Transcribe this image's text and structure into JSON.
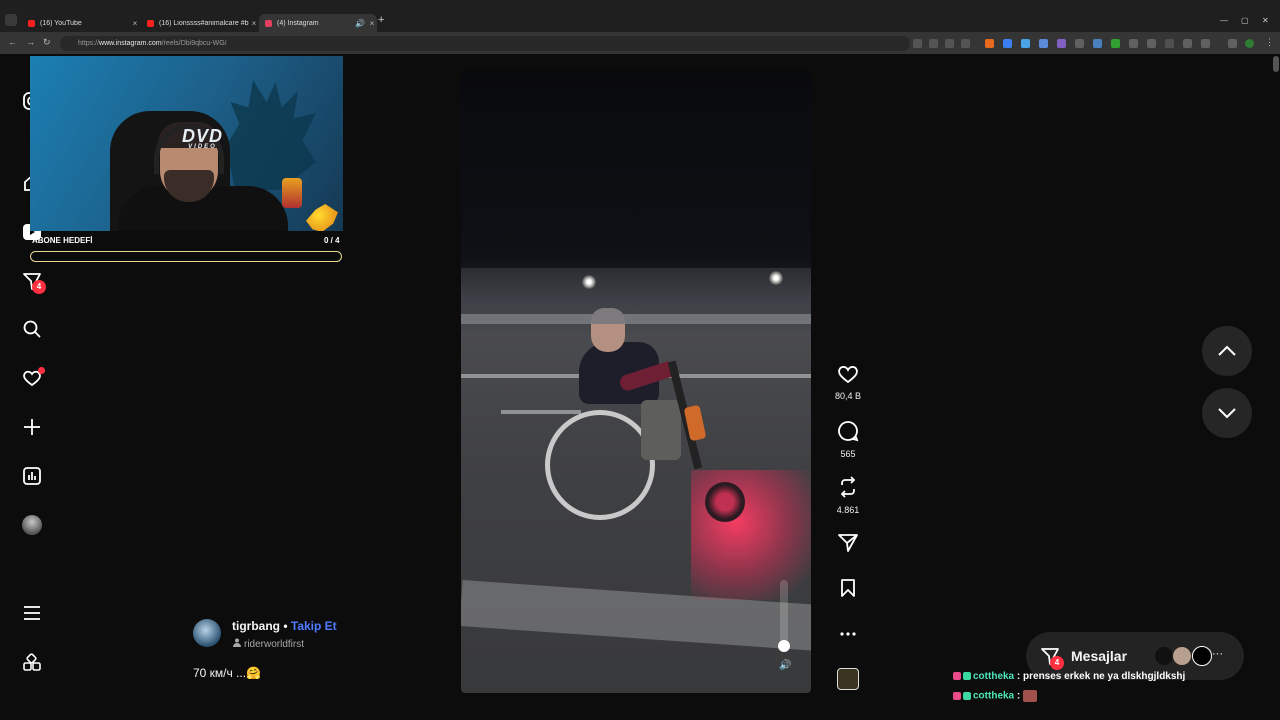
{
  "browser": {
    "tabs": [
      {
        "title": "(16) YouTube",
        "favicon_color": "#ff2020",
        "active": false
      },
      {
        "title": "(16) Lionssss#animalcare #big",
        "favicon_color": "#ff2020",
        "active": false
      },
      {
        "title": "(4) Instagram",
        "favicon_color": "#e4405f",
        "active": true
      }
    ],
    "close_glyph": "×",
    "new_tab_glyph": "+",
    "url_prefix": "https://",
    "url_host": "www.instagram.com",
    "url_path": "/reels/Dbi9qbcu-WG/",
    "window_controls": [
      "—",
      "▢",
      "✕"
    ]
  },
  "overlay": {
    "goal_label": "ABONE HEDEFİ",
    "goal_count": "0 / 4",
    "dvd_text": "DVD",
    "dvd_sub": "VIDEO"
  },
  "sidebar": {
    "icons": [
      "instagram-icon",
      "home-icon",
      "reels-icon",
      "direct-icon",
      "search-icon",
      "notifications-icon",
      "create-icon",
      "dashboard-icon",
      "profile-avatar",
      "menu-icon",
      "apps-icon"
    ],
    "direct_badge": "4"
  },
  "reel": {
    "username": "tigrbang",
    "separator": " • ",
    "follow_label": "Takip Et",
    "audio": "riderworldfirst",
    "caption": "70 км/ч ...🤗",
    "likes": "80,4 B",
    "comments": "565",
    "reposts": "4.861",
    "volume_glyph": "🔊"
  },
  "messages": {
    "label": "Mesajlar",
    "badge": "4",
    "more_glyph": "···"
  },
  "chat": [
    {
      "user": "cottheka",
      "sep": " : ",
      "text": "prenses erkek ne ya dlskhgjldkshj"
    },
    {
      "user": "cottheka",
      "sep": " : ",
      "text": ""
    }
  ],
  "colors": {
    "accent": "#4f7cff",
    "badge": "#ff3040",
    "chat_user": "#4ee7b8",
    "goal_border": "#e9d892"
  }
}
